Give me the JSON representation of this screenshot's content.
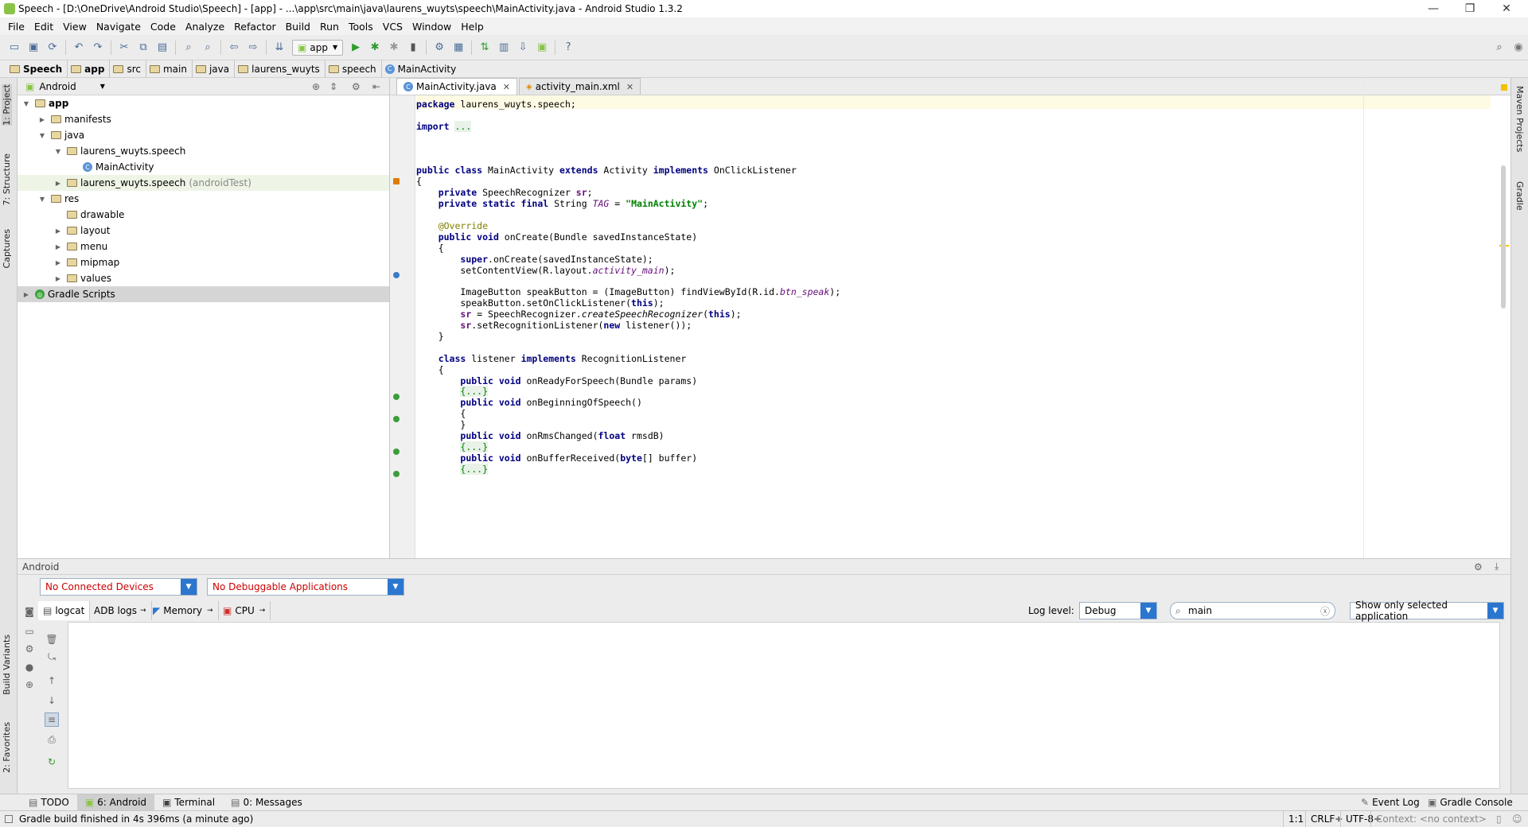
{
  "window": {
    "title": "Speech - [D:\\OneDrive\\Android Studio\\Speech] - [app] - ...\\app\\src\\main\\java\\laurens_wuyts\\speech\\MainActivity.java - Android Studio 1.3.2",
    "minimize": "—",
    "restore": "❐",
    "close": "✕"
  },
  "menu": [
    "File",
    "Edit",
    "View",
    "Navigate",
    "Code",
    "Analyze",
    "Refactor",
    "Build",
    "Run",
    "Tools",
    "VCS",
    "Window",
    "Help"
  ],
  "toolbar": {
    "run_config": "app"
  },
  "breadcrumb": [
    "Speech",
    "app",
    "src",
    "main",
    "java",
    "laurens_wuyts",
    "speech",
    "MainActivity"
  ],
  "side_tabs": {
    "left": [
      "1: Project",
      "7: Structure",
      "Captures",
      "Build Variants",
      "2: Favorites"
    ],
    "right": [
      "Maven Projects",
      "Gradle"
    ]
  },
  "project": {
    "view": "Android",
    "tree": [
      {
        "label": "app",
        "bold": true,
        "indent": 0,
        "kind": "module",
        "open": true
      },
      {
        "label": "manifests",
        "indent": 1,
        "kind": "folder",
        "open": false
      },
      {
        "label": "java",
        "indent": 1,
        "kind": "folder",
        "open": true
      },
      {
        "label": "laurens_wuyts.speech",
        "indent": 2,
        "kind": "package",
        "open": true
      },
      {
        "label": "MainActivity",
        "indent": 3,
        "kind": "class"
      },
      {
        "label": "laurens_wuyts.speech",
        "suffix": "(androidTest)",
        "indent": 2,
        "kind": "package",
        "open": false
      },
      {
        "label": "res",
        "indent": 1,
        "kind": "folder",
        "open": true
      },
      {
        "label": "drawable",
        "indent": 2,
        "kind": "folder"
      },
      {
        "label": "layout",
        "indent": 2,
        "kind": "folder",
        "open": false
      },
      {
        "label": "menu",
        "indent": 2,
        "kind": "folder",
        "open": false
      },
      {
        "label": "mipmap",
        "indent": 2,
        "kind": "folder",
        "open": false
      },
      {
        "label": "values",
        "indent": 2,
        "kind": "folder",
        "open": false
      },
      {
        "label": "Gradle Scripts",
        "indent": 0,
        "kind": "gradle",
        "open": false,
        "selected": true
      }
    ]
  },
  "editor": {
    "tabs": [
      {
        "label": "MainActivity.java",
        "active": true
      },
      {
        "label": "activity_main.xml",
        "active": false
      }
    ],
    "lines": [
      {
        "row": 0,
        "html": "<span class=\"kw\">package</span> laurens_wuyts.speech;"
      },
      {
        "row": 2,
        "html": "<span class=\"kw\">import</span> <span class=\"fold\">...</span>"
      },
      {
        "row": 6,
        "html": "<span class=\"kw\">public class</span> MainActivity <span class=\"kw\">extends</span> Activity <span class=\"kw\">implements</span> OnClickListener"
      },
      {
        "row": 7,
        "html": "{"
      },
      {
        "row": 8,
        "html": "    <span class=\"kw\">private</span> SpeechRecognizer <span class=\"fld\">sr</span>;"
      },
      {
        "row": 9,
        "html": "    <span class=\"kw\">private static final</span> String <span class=\"stf\">TAG</span> = <span class=\"str\">\"MainActivity\"</span>;"
      },
      {
        "row": 11,
        "html": "    <span class=\"ann\">@Override</span>"
      },
      {
        "row": 12,
        "html": "    <span class=\"kw\">public void</span> onCreate(Bundle savedInstanceState)"
      },
      {
        "row": 13,
        "html": "    {"
      },
      {
        "row": 14,
        "html": "        <span class=\"kw\">super</span>.onCreate(savedInstanceState);"
      },
      {
        "row": 15,
        "html": "        setContentView(R.layout.<span class=\"stf\">activity_main</span>);"
      },
      {
        "row": 17,
        "html": "        ImageButton speakButton = (ImageButton) findViewById(R.id.<span class=\"stf\">btn_speak</span>);"
      },
      {
        "row": 18,
        "html": "        speakButton.setOnClickListener(<span class=\"kw\">this</span>);"
      },
      {
        "row": 19,
        "html": "        <span class=\"fld\">sr</span> = SpeechRecognizer.<i>createSpeechRecognizer</i>(<span class=\"kw\">this</span>);"
      },
      {
        "row": 20,
        "html": "        <span class=\"fld\">sr</span>.setRecognitionListener(<span class=\"kw\">new</span> listener());"
      },
      {
        "row": 21,
        "html": "    }"
      },
      {
        "row": 23,
        "html": "    <span class=\"kw\">class</span> listener <span class=\"kw\">implements</span> RecognitionListener"
      },
      {
        "row": 24,
        "html": "    {"
      },
      {
        "row": 25,
        "html": "        <span class=\"kw\">public void</span> onReadyForSpeech(Bundle params)"
      },
      {
        "row": 26,
        "html": "        <span class=\"fold\">{...}</span>"
      },
      {
        "row": 27,
        "html": "        <span class=\"kw\">public void</span> onBeginningOfSpeech()"
      },
      {
        "row": 28,
        "html": "        {"
      },
      {
        "row": 29,
        "html": "        }"
      },
      {
        "row": 30,
        "html": "        <span class=\"kw\">public void</span> onRmsChanged(<span class=\"kw\">float</span> rmsdB)"
      },
      {
        "row": 31,
        "html": "        <span class=\"fold\">{...}</span>"
      },
      {
        "row": 32,
        "html": "        <span class=\"kw\">public void</span> onBufferReceived(<span class=\"kw\">byte</span>[] buffer)"
      },
      {
        "row": 33,
        "html": "        <span class=\"fold\">{...}</span>"
      }
    ]
  },
  "android_panel": {
    "title": "Android",
    "devices": "No Connected Devices",
    "apps": "No Debuggable Applications",
    "tabs": [
      "logcat",
      "ADB logs",
      "Memory",
      "CPU"
    ],
    "log_level_label": "Log level:",
    "log_level": "Debug",
    "search_value": "main",
    "filter": "Show only selected application"
  },
  "bottom_tabs": [
    "TODO",
    "6: Android",
    "Terminal",
    "0: Messages"
  ],
  "bottom_right_tabs": [
    "Event Log",
    "Gradle Console"
  ],
  "status": {
    "message": "Gradle build finished in 4s 396ms (a minute ago)",
    "position": "1:1",
    "line_sep": "CRLF÷",
    "encoding": "UTF-8÷",
    "context": "Context: <no context>"
  },
  "colors": {
    "accent": "#2b76cf",
    "error_text": "#cc0000",
    "selection": "#d5d5d5"
  }
}
